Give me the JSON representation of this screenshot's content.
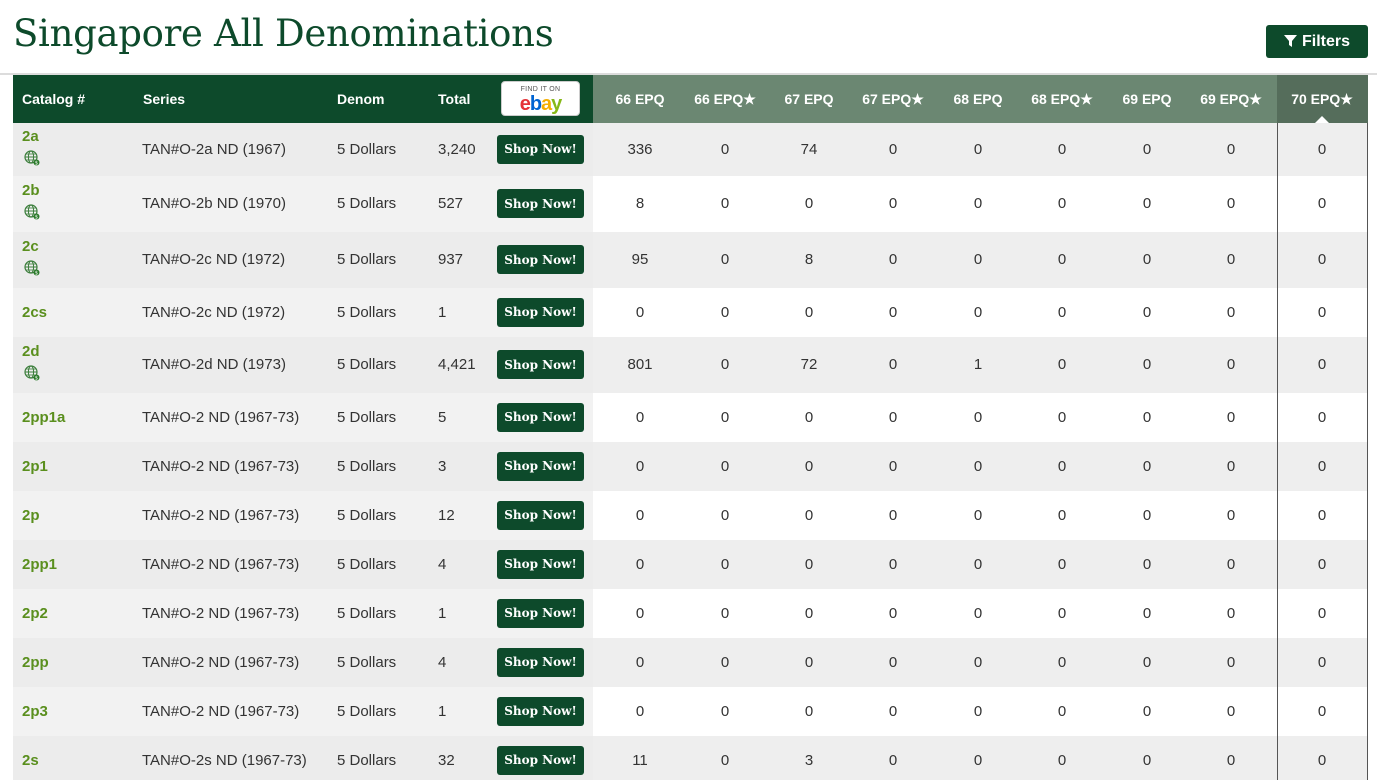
{
  "page": {
    "title": "Singapore All Denominations",
    "filters_label": "Filters"
  },
  "colors": {
    "brand_green": "#0d4a2b",
    "link_green": "#5a8f1e",
    "grade_header": "#6b8772"
  },
  "ebay_badge": {
    "small_text": "FIND IT ON",
    "letters": [
      "e",
      "b",
      "a",
      "y"
    ]
  },
  "table": {
    "headers": {
      "catalog": "Catalog #",
      "series": "Series",
      "denom": "Denom",
      "total": "Total",
      "grades": [
        "66 EPQ",
        "66 EPQ★",
        "67 EPQ",
        "67 EPQ★",
        "68 EPQ",
        "68 EPQ★",
        "69 EPQ",
        "69 EPQ★",
        "70 EPQ★"
      ]
    },
    "active_grade_index": 8,
    "shop_label": "Shop Now!",
    "rows": [
      {
        "catalog": "2a",
        "has_globe": true,
        "series": "TAN#O-2a ND (1967)",
        "denom": "5 Dollars",
        "total": "3,240",
        "grades": [
          "336",
          "0",
          "74",
          "0",
          "0",
          "0",
          "0",
          "0",
          "0"
        ]
      },
      {
        "catalog": "2b",
        "has_globe": true,
        "series": "TAN#O-2b ND (1970)",
        "denom": "5 Dollars",
        "total": "527",
        "grades": [
          "8",
          "0",
          "0",
          "0",
          "0",
          "0",
          "0",
          "0",
          "0"
        ]
      },
      {
        "catalog": "2c",
        "has_globe": true,
        "series": "TAN#O-2c ND (1972)",
        "denom": "5 Dollars",
        "total": "937",
        "grades": [
          "95",
          "0",
          "8",
          "0",
          "0",
          "0",
          "0",
          "0",
          "0"
        ]
      },
      {
        "catalog": "2cs",
        "has_globe": false,
        "series": "TAN#O-2c ND (1972)",
        "denom": "5 Dollars",
        "total": "1",
        "grades": [
          "0",
          "0",
          "0",
          "0",
          "0",
          "0",
          "0",
          "0",
          "0"
        ]
      },
      {
        "catalog": "2d",
        "has_globe": true,
        "series": "TAN#O-2d ND (1973)",
        "denom": "5 Dollars",
        "total": "4,421",
        "grades": [
          "801",
          "0",
          "72",
          "0",
          "1",
          "0",
          "0",
          "0",
          "0"
        ]
      },
      {
        "catalog": "2pp1a",
        "has_globe": false,
        "series": "TAN#O-2 ND (1967-73)",
        "denom": "5 Dollars",
        "total": "5",
        "grades": [
          "0",
          "0",
          "0",
          "0",
          "0",
          "0",
          "0",
          "0",
          "0"
        ]
      },
      {
        "catalog": "2p1",
        "has_globe": false,
        "series": "TAN#O-2 ND (1967-73)",
        "denom": "5 Dollars",
        "total": "3",
        "grades": [
          "0",
          "0",
          "0",
          "0",
          "0",
          "0",
          "0",
          "0",
          "0"
        ]
      },
      {
        "catalog": "2p",
        "has_globe": false,
        "series": "TAN#O-2 ND (1967-73)",
        "denom": "5 Dollars",
        "total": "12",
        "grades": [
          "0",
          "0",
          "0",
          "0",
          "0",
          "0",
          "0",
          "0",
          "0"
        ]
      },
      {
        "catalog": "2pp1",
        "has_globe": false,
        "series": "TAN#O-2 ND (1967-73)",
        "denom": "5 Dollars",
        "total": "4",
        "grades": [
          "0",
          "0",
          "0",
          "0",
          "0",
          "0",
          "0",
          "0",
          "0"
        ]
      },
      {
        "catalog": "2p2",
        "has_globe": false,
        "series": "TAN#O-2 ND (1967-73)",
        "denom": "5 Dollars",
        "total": "1",
        "grades": [
          "0",
          "0",
          "0",
          "0",
          "0",
          "0",
          "0",
          "0",
          "0"
        ]
      },
      {
        "catalog": "2pp",
        "has_globe": false,
        "series": "TAN#O-2 ND (1967-73)",
        "denom": "5 Dollars",
        "total": "4",
        "grades": [
          "0",
          "0",
          "0",
          "0",
          "0",
          "0",
          "0",
          "0",
          "0"
        ]
      },
      {
        "catalog": "2p3",
        "has_globe": false,
        "series": "TAN#O-2 ND (1967-73)",
        "denom": "5 Dollars",
        "total": "1",
        "grades": [
          "0",
          "0",
          "0",
          "0",
          "0",
          "0",
          "0",
          "0",
          "0"
        ]
      },
      {
        "catalog": "2s",
        "has_globe": false,
        "series": "TAN#O-2s ND (1967-73)",
        "denom": "5 Dollars",
        "total": "32",
        "grades": [
          "11",
          "0",
          "3",
          "0",
          "0",
          "0",
          "0",
          "0",
          "0"
        ]
      }
    ]
  }
}
